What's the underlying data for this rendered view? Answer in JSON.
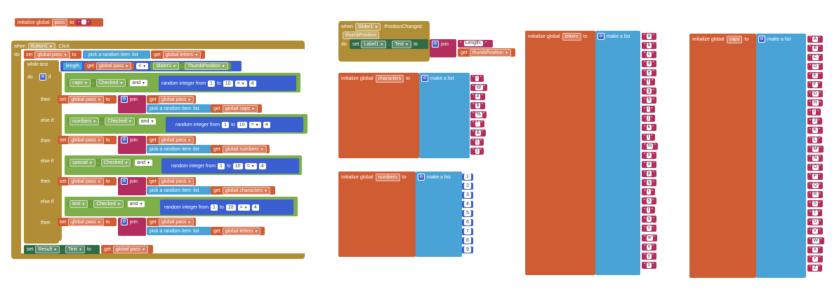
{
  "init_pass": {
    "prefix": "initialize global",
    "name": "pass",
    "to": "to",
    "value": "\""
  },
  "button_event": {
    "when": "when",
    "component": "Button1",
    "event": ".Click",
    "do": "do",
    "set_kw": "set",
    "global_pass": "global pass",
    "to": "to",
    "pick": "pick a random item",
    "list_kw": "list",
    "get": "get",
    "global_letters": "global letters",
    "while_test": "while test",
    "length": "length",
    "lt": "<",
    "slider": "Slider1",
    "thumb_prop": "ThumbPosition",
    "do_kw": "do",
    "if_kw": "if",
    "then_kw": "then",
    "else_if": "else if",
    "join": "join",
    "and_kw": "and",
    "random": "random integer from",
    "from_val": "1",
    "to_kw": "to",
    "to_val": "10",
    "eq": "=",
    "dot": ".",
    "checked": "Checked",
    "branches": [
      {
        "cond_component": "caps",
        "compare": "4",
        "list_var": "global caps"
      },
      {
        "cond_component": "numbers",
        "compare": "4",
        "list_var": "global numbers"
      },
      {
        "cond_component": "special",
        "compare": "4",
        "list_var": "global characters"
      },
      {
        "cond_component": "text",
        "compare": "4",
        "list_var": "global letters"
      }
    ],
    "final_set": "set",
    "result": "Result",
    "text_prop": "Text",
    "get_pass": "global pass"
  },
  "slider_event": {
    "when": "when",
    "component": "Slider1",
    "event": ".PositionChanged",
    "param": "thumbPosition",
    "do": "do",
    "set_kw": "set",
    "label": "Label1",
    "text_prop": "Text",
    "to": "to",
    "join": "join",
    "length_str": "Length: ",
    "get": "get",
    "thumb": "thumbPosition"
  },
  "characters": {
    "prefix": "initialize global",
    "name": "characters",
    "to": "to",
    "make": "make a list",
    "items": [
      "!",
      "@",
      "#",
      "$",
      "%",
      "^",
      "&",
      "(",
      ")"
    ]
  },
  "numbers": {
    "prefix": "initialize global",
    "name": "numbers",
    "to": "to",
    "make": "make a list",
    "items": [
      "1",
      "2",
      "3",
      "4",
      "5",
      "6",
      "7",
      "8",
      "9"
    ]
  },
  "letters": {
    "prefix": "initialize global",
    "name": "letters",
    "to": "to",
    "make": "make a list",
    "items": [
      "a",
      "b",
      "c",
      "d",
      "e",
      "f",
      "g",
      "h",
      "i",
      "j",
      "k",
      "l",
      "m",
      "n",
      "o",
      "p",
      "q",
      "r",
      "s",
      "t",
      "u",
      "v",
      "w",
      "x",
      "y",
      "z"
    ]
  },
  "caps": {
    "prefix": "initialize global",
    "name": "caps",
    "to": "to",
    "make": "make a list",
    "items": [
      "A",
      "B",
      "C",
      "D",
      "E",
      "F",
      "G",
      "H",
      "I",
      "J",
      "K",
      "L",
      "M",
      "N",
      "O",
      "P",
      "Q",
      "R",
      "S",
      "T",
      "U",
      "V",
      "W",
      "X",
      "Y",
      "Z"
    ]
  }
}
